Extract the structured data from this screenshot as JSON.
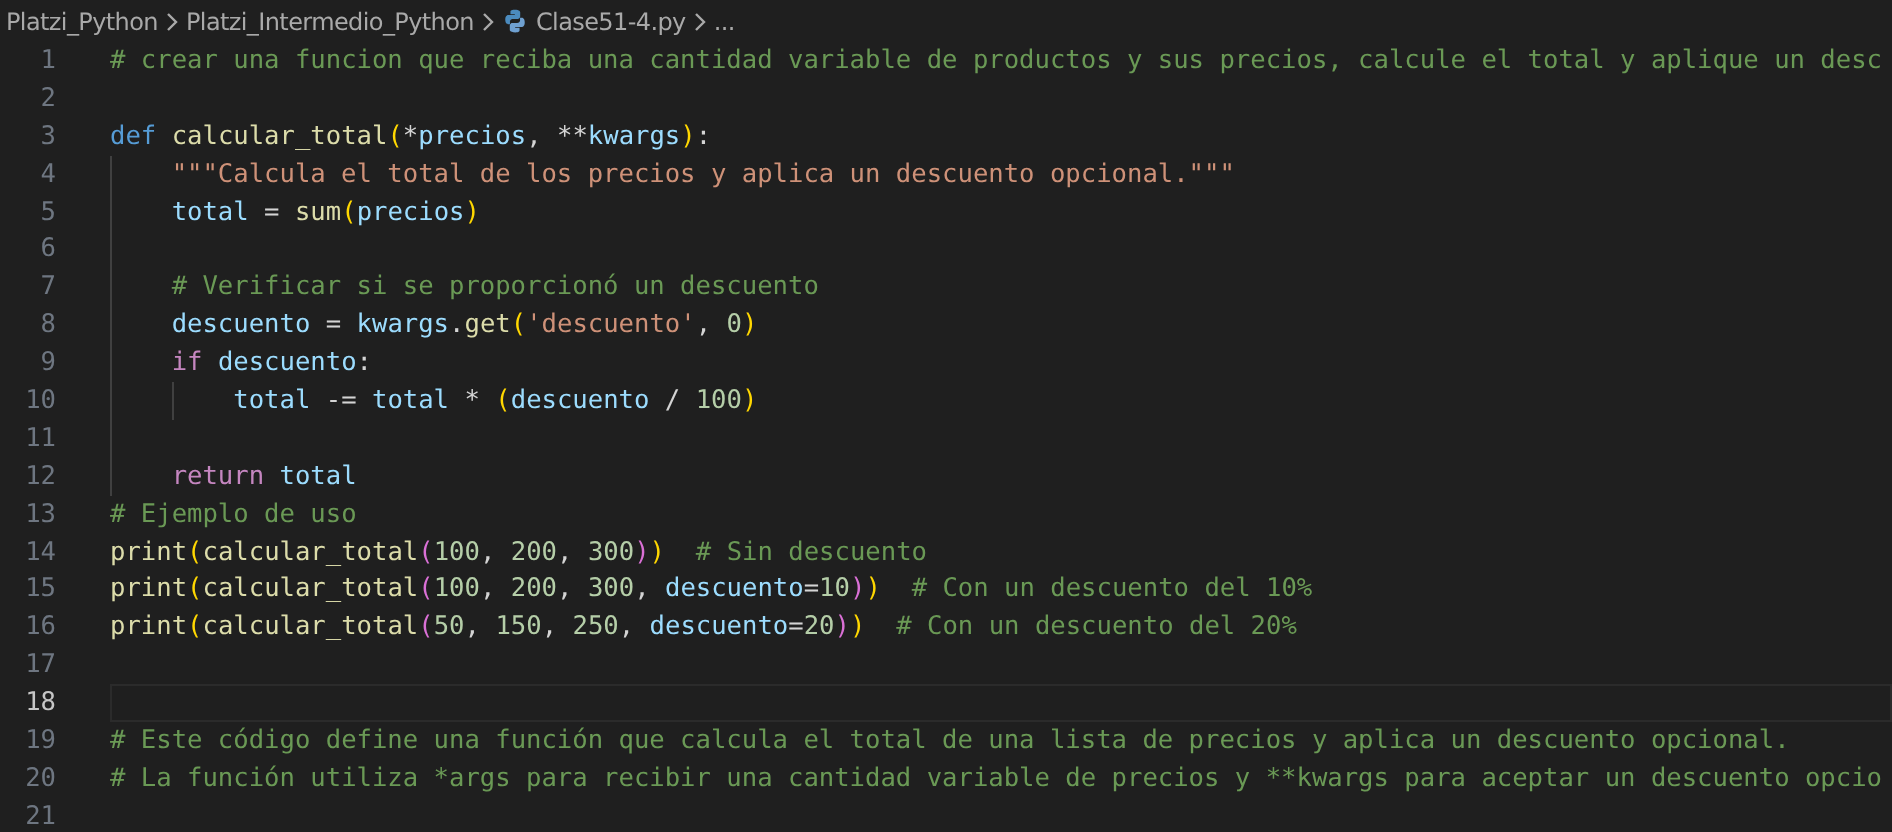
{
  "breadcrumb": [
    {
      "label": "Platzi_Python",
      "kind": "folder"
    },
    {
      "label": "Platzi_Intermedio_Python",
      "kind": "folder"
    },
    {
      "label": "Clase51-4.py",
      "kind": "python-file"
    },
    {
      "label": "...",
      "kind": "more"
    }
  ],
  "lines": [
    {
      "number": "1",
      "current": false,
      "tokens": [
        {
          "text": "# crear una funcion que reciba una cantidad variable de productos y sus precios, calcule el total y aplique un desc",
          "kind": "comment"
        }
      ]
    },
    {
      "number": "2",
      "current": false
    },
    {
      "number": "3",
      "current": false,
      "tokens": [
        {
          "text": "def ",
          "kind": "keyword"
        },
        {
          "text": "calcular_total",
          "kind": "function"
        },
        {
          "text": "(",
          "kind": "bracket1"
        },
        {
          "text": "*",
          "kind": "plain"
        },
        {
          "text": "precios",
          "kind": "variable"
        },
        {
          "text": ", **",
          "kind": "plain"
        },
        {
          "text": "kwargs",
          "kind": "variable"
        },
        {
          "text": ")",
          "kind": "bracket1"
        },
        {
          "text": ":",
          "kind": "plain"
        }
      ],
      "children": [
        {
          "number": "4",
          "current": false,
          "tokens": [
            {
              "text": "\"\"\"Calcula el total de los precios y aplica un descuento opcional.\"\"\"",
              "kind": "string"
            }
          ]
        },
        {
          "number": "5",
          "current": false,
          "tokens": [
            {
              "text": "total",
              "kind": "variable"
            },
            {
              "text": " = ",
              "kind": "plain"
            },
            {
              "text": "sum",
              "kind": "function"
            },
            {
              "text": "(",
              "kind": "bracket1"
            },
            {
              "text": "precios",
              "kind": "variable"
            },
            {
              "text": ")",
              "kind": "bracket1"
            }
          ]
        },
        {
          "number": "6",
          "current": false
        },
        {
          "number": "7",
          "current": false,
          "tokens": [
            {
              "text": "# Verificar si se proporcionó un descuento",
              "kind": "comment"
            }
          ]
        },
        {
          "number": "8",
          "current": false,
          "tokens": [
            {
              "text": "descuento",
              "kind": "variable"
            },
            {
              "text": " = ",
              "kind": "plain"
            },
            {
              "text": "kwargs",
              "kind": "variable"
            },
            {
              "text": ".",
              "kind": "plain"
            },
            {
              "text": "get",
              "kind": "function"
            },
            {
              "text": "(",
              "kind": "bracket1"
            },
            {
              "text": "'descuento'",
              "kind": "string"
            },
            {
              "text": ", ",
              "kind": "plain"
            },
            {
              "text": "0",
              "kind": "number"
            },
            {
              "text": ")",
              "kind": "bracket1"
            }
          ]
        },
        {
          "number": "9",
          "current": false,
          "tokens": [
            {
              "text": "if ",
              "kind": "control"
            },
            {
              "text": "descuento",
              "kind": "variable"
            },
            {
              "text": ":",
              "kind": "plain"
            }
          ],
          "children": [
            {
              "number": "10",
              "current": false,
              "tokens": [
                {
                  "text": "total",
                  "kind": "variable"
                },
                {
                  "text": " -= ",
                  "kind": "plain"
                },
                {
                  "text": "total",
                  "kind": "variable"
                },
                {
                  "text": " * ",
                  "kind": "plain"
                },
                {
                  "text": "(",
                  "kind": "bracket1"
                },
                {
                  "text": "descuento",
                  "kind": "variable"
                },
                {
                  "text": " / ",
                  "kind": "plain"
                },
                {
                  "text": "100",
                  "kind": "number"
                },
                {
                  "text": ")",
                  "kind": "bracket1"
                }
              ]
            }
          ]
        },
        {
          "number": "11",
          "current": false
        },
        {
          "number": "12",
          "current": false,
          "tokens": [
            {
              "text": "return ",
              "kind": "control"
            },
            {
              "text": "total",
              "kind": "variable"
            }
          ]
        }
      ]
    },
    {
      "number": "13",
      "current": false,
      "tokens": [
        {
          "text": "# Ejemplo de uso",
          "kind": "comment"
        }
      ]
    },
    {
      "number": "14",
      "current": false,
      "tokens": [
        {
          "text": "print",
          "kind": "function"
        },
        {
          "text": "(",
          "kind": "bracket1"
        },
        {
          "text": "calcular_total",
          "kind": "function"
        },
        {
          "text": "(",
          "kind": "bracket2"
        },
        {
          "text": "100",
          "kind": "number"
        },
        {
          "text": ", ",
          "kind": "plain"
        },
        {
          "text": "200",
          "kind": "number"
        },
        {
          "text": ", ",
          "kind": "plain"
        },
        {
          "text": "300",
          "kind": "number"
        },
        {
          "text": ")",
          "kind": "bracket2"
        },
        {
          "text": ")  ",
          "kind": "bracket1"
        },
        {
          "text": "# Sin descuento",
          "kind": "comment"
        }
      ]
    },
    {
      "number": "15",
      "current": false,
      "tokens": [
        {
          "text": "print",
          "kind": "function"
        },
        {
          "text": "(",
          "kind": "bracket1"
        },
        {
          "text": "calcular_total",
          "kind": "function"
        },
        {
          "text": "(",
          "kind": "bracket2"
        },
        {
          "text": "100",
          "kind": "number"
        },
        {
          "text": ", ",
          "kind": "plain"
        },
        {
          "text": "200",
          "kind": "number"
        },
        {
          "text": ", ",
          "kind": "plain"
        },
        {
          "text": "300",
          "kind": "number"
        },
        {
          "text": ", ",
          "kind": "plain"
        },
        {
          "text": "descuento",
          "kind": "variable"
        },
        {
          "text": "=",
          "kind": "plain"
        },
        {
          "text": "10",
          "kind": "number"
        },
        {
          "text": ")",
          "kind": "bracket2"
        },
        {
          "text": ")  ",
          "kind": "bracket1"
        },
        {
          "text": "# Con un descuento del 10%",
          "kind": "comment"
        }
      ]
    },
    {
      "number": "16",
      "current": false,
      "tokens": [
        {
          "text": "print",
          "kind": "function"
        },
        {
          "text": "(",
          "kind": "bracket1"
        },
        {
          "text": "calcular_total",
          "kind": "function"
        },
        {
          "text": "(",
          "kind": "bracket2"
        },
        {
          "text": "50",
          "kind": "number"
        },
        {
          "text": ", ",
          "kind": "plain"
        },
        {
          "text": "150",
          "kind": "number"
        },
        {
          "text": ", ",
          "kind": "plain"
        },
        {
          "text": "250",
          "kind": "number"
        },
        {
          "text": ", ",
          "kind": "plain"
        },
        {
          "text": "descuento",
          "kind": "variable"
        },
        {
          "text": "=",
          "kind": "plain"
        },
        {
          "text": "20",
          "kind": "number"
        },
        {
          "text": ")",
          "kind": "bracket2"
        },
        {
          "text": ")  ",
          "kind": "bracket1"
        },
        {
          "text": "# Con un descuento del 20%",
          "kind": "comment"
        }
      ]
    },
    {
      "number": "17",
      "current": false
    },
    {
      "number": "18",
      "current": true
    },
    {
      "number": "19",
      "current": false,
      "tokens": [
        {
          "text": "# Este código define una función que calcula el total de una lista de precios y aplica un descuento opcional.",
          "kind": "comment"
        }
      ]
    },
    {
      "number": "20",
      "current": false,
      "tokens": [
        {
          "text": "# La función utiliza *args para recibir una cantidad variable de precios y **kwargs para aceptar un descuento opcio",
          "kind": "comment"
        }
      ]
    },
    {
      "number": "21",
      "current": false
    }
  ]
}
